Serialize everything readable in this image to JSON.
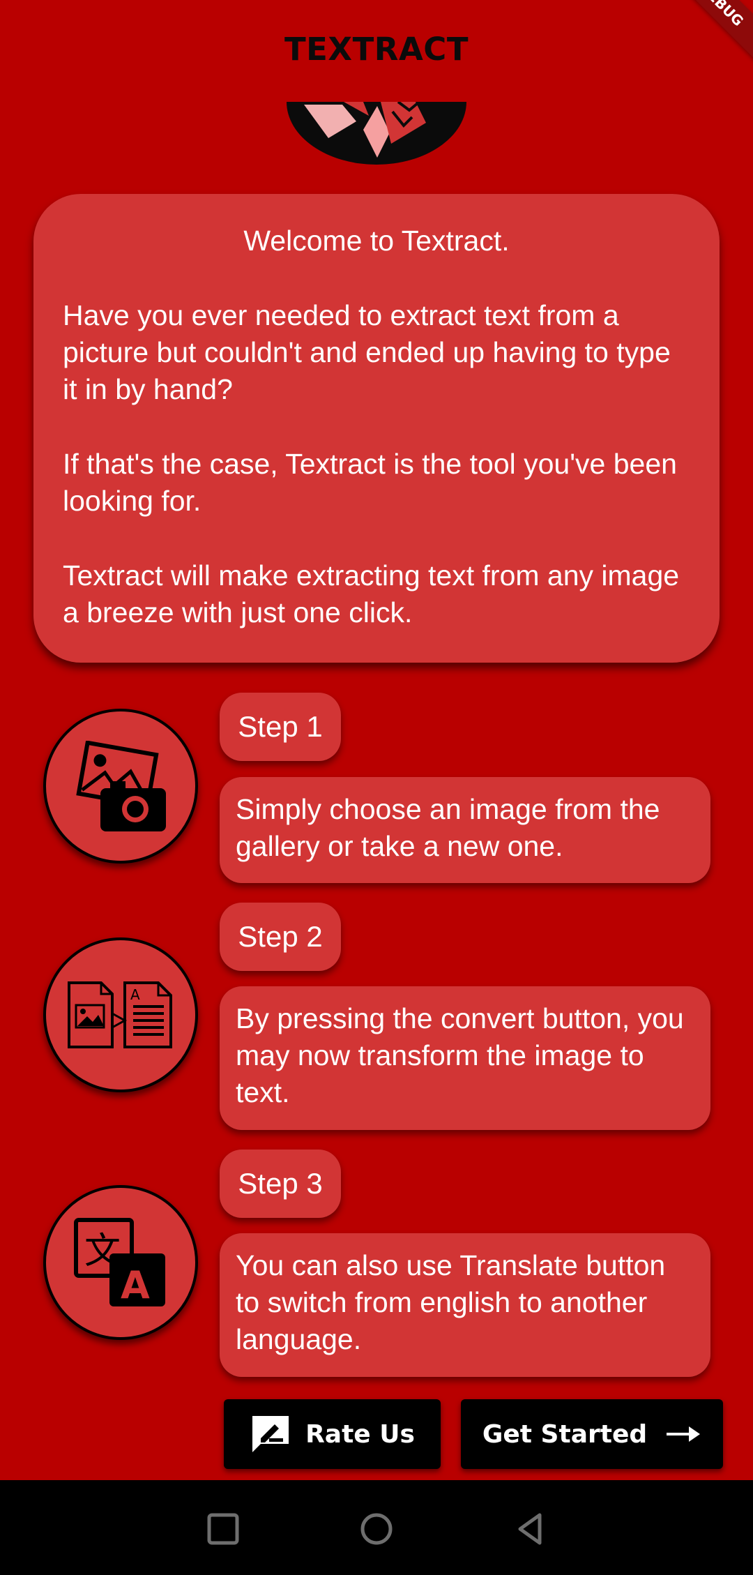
{
  "app": {
    "title": "TEXTRACT",
    "debug_banner": "DEBUG"
  },
  "welcome": {
    "title": "Welcome to Textract.",
    "paragraph1": "Have you ever needed to extract text from a picture but couldn't and ended up having to type it in by hand?",
    "paragraph2": "If that's the case, Textract is the tool you've been looking for.",
    "paragraph3": "Textract will make extracting text from any image a breeze with just one click."
  },
  "steps": [
    {
      "label": "Step 1",
      "text": "Simply choose an image from the gallery or take a new one.",
      "icon": "gallery-camera-icon"
    },
    {
      "label": "Step 2",
      "text": "By pressing the convert button, you may now transform the image to text.",
      "icon": "image-to-text-icon"
    },
    {
      "label": "Step 3",
      "text": "You can also use Translate button to switch from english to another language.",
      "icon": "translate-icon"
    }
  ],
  "buttons": {
    "rate_us": "Rate Us",
    "get_started": "Get Started"
  },
  "colors": {
    "background": "#b90000",
    "card": "#d23535",
    "button": "#000000",
    "text": "#ffffff"
  }
}
